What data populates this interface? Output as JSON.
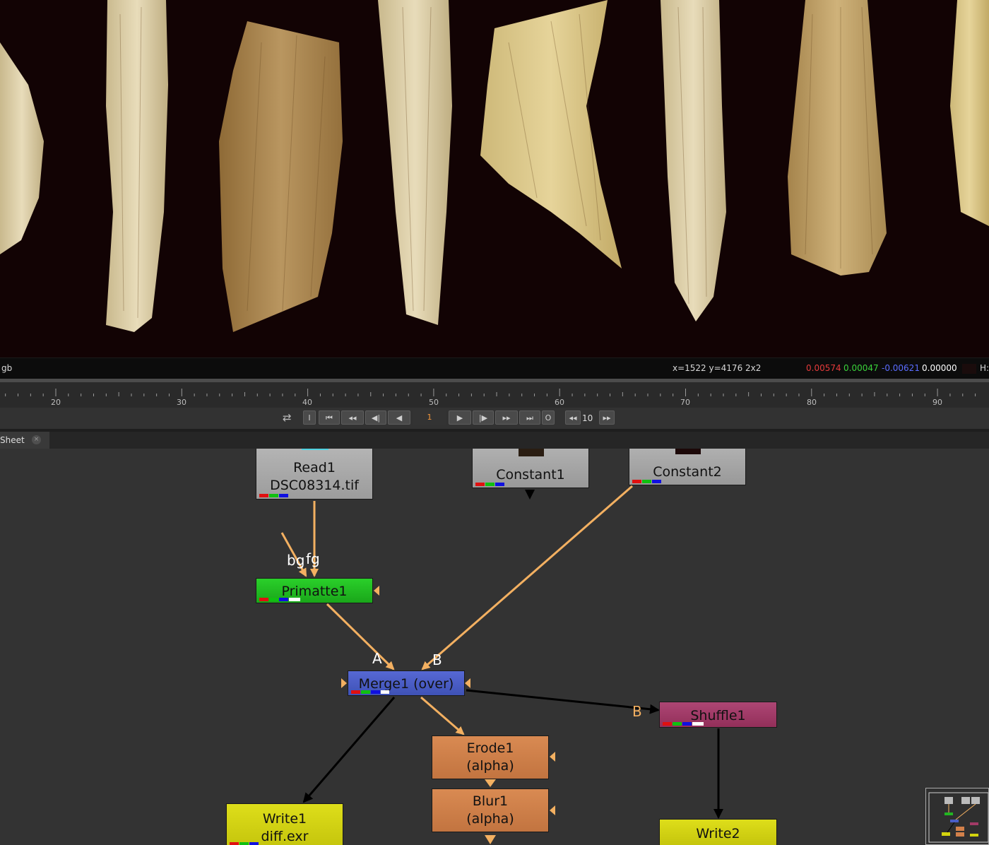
{
  "infobar": {
    "channel_label": "gb",
    "coords": "x=1522 y=4176 2x2",
    "red_value": "0.00574",
    "green_value": "0.00047",
    "blue_value": "-0.00621",
    "alpha_value": "0.00000",
    "hsv_label": "H:"
  },
  "timeline": {
    "ticks": [
      "20",
      "30",
      "40",
      "50",
      "60",
      "70",
      "80",
      "90"
    ]
  },
  "transport": {
    "in_label": "I",
    "out_label": "O",
    "current_frame": "1",
    "step_value": "10"
  },
  "tabs": {
    "node_graph_label": "Sheet",
    "close_glyph": "×"
  },
  "nodes": {
    "read1_line1": "Read1",
    "read1_line2": "DSC08314.tif",
    "constant1": "Constant1",
    "constant2": "Constant2",
    "primatte1": "Primatte1",
    "merge1": "Merge1 (over)",
    "shuffle1": "Shuffle1",
    "erode1_line1": "Erode1",
    "erode1_line2": "(alpha)",
    "blur1_line1": "Blur1",
    "blur1_line2": "(alpha)",
    "write1_line1": "Write1",
    "write1_line2": "diff.exr",
    "write2": "Write2"
  },
  "edge_labels": {
    "bg": "bg",
    "fg": "fg",
    "a": "A",
    "b": "B",
    "shuffle_b": "B"
  },
  "colors": {
    "read": "#a9a9a9",
    "constant": "#a3a3a3",
    "primatte": "#22b622",
    "merge": "#4a5ec6",
    "shuffle": "#a23a66",
    "filter": "#d2804a",
    "write": "#d4d40e",
    "edge": "#f3b061",
    "edge_dark": "#000000"
  }
}
